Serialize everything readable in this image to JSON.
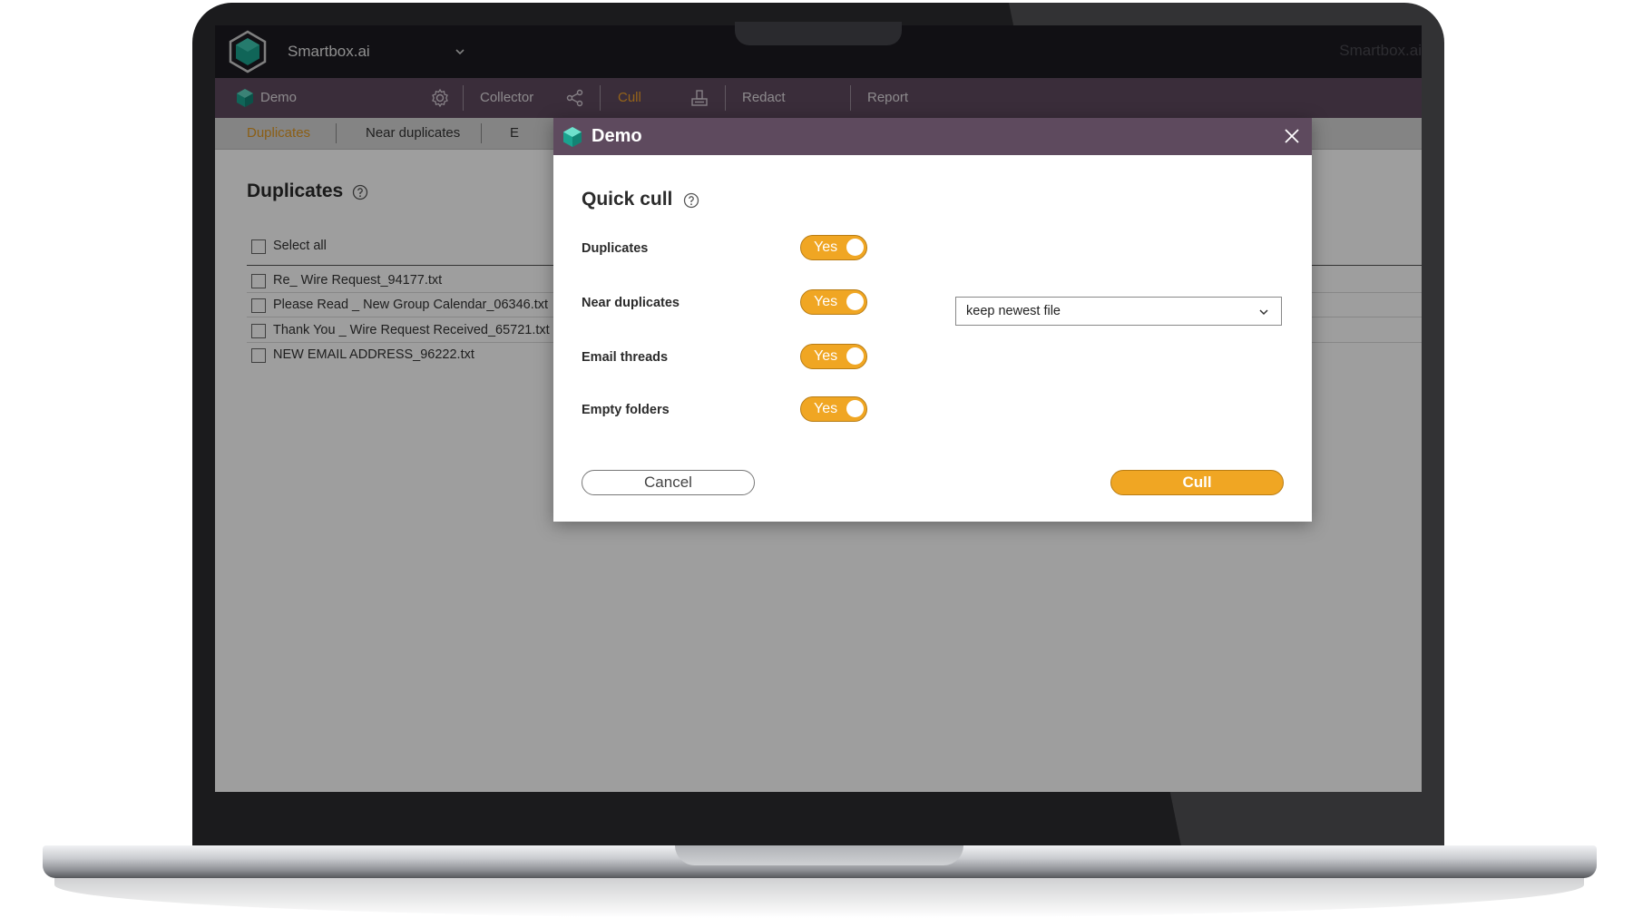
{
  "app": {
    "brand": "Smartbox.ai",
    "brand_right": "Smartbox.ai"
  },
  "nav": {
    "project": "Demo",
    "items": [
      {
        "label": "Collector",
        "active": false
      },
      {
        "label": "Cull",
        "active": true
      },
      {
        "label": "Redact",
        "active": false
      },
      {
        "label": "Report",
        "active": false
      }
    ]
  },
  "subnav": {
    "items": [
      {
        "label": "Duplicates",
        "active": true
      },
      {
        "label": "Near duplicates",
        "active": false
      },
      {
        "label": "E",
        "active": false
      }
    ]
  },
  "page": {
    "title": "Duplicates",
    "select_all": "Select all",
    "files": [
      "Re_ Wire Request_94177.txt",
      "Please Read _ New Group Calendar_06346.txt",
      "Thank You _ Wire Request Received_65721.txt",
      "NEW EMAIL ADDRESS_96222.txt"
    ]
  },
  "modal": {
    "title": "Demo",
    "heading": "Quick cull",
    "options": [
      {
        "label": "Duplicates",
        "toggle": "Yes"
      },
      {
        "label": "Near duplicates",
        "toggle": "Yes"
      },
      {
        "label": "Email threads",
        "toggle": "Yes"
      },
      {
        "label": "Empty folders",
        "toggle": "Yes"
      }
    ],
    "near_duplicates_select": "keep newest file",
    "cancel_label": "Cancel",
    "cull_label": "Cull"
  },
  "colors": {
    "accent": "#f0a623",
    "header_bg": "#1c1a21",
    "nav_bg": "#5e4a5e",
    "logo": "#1aa38f"
  }
}
